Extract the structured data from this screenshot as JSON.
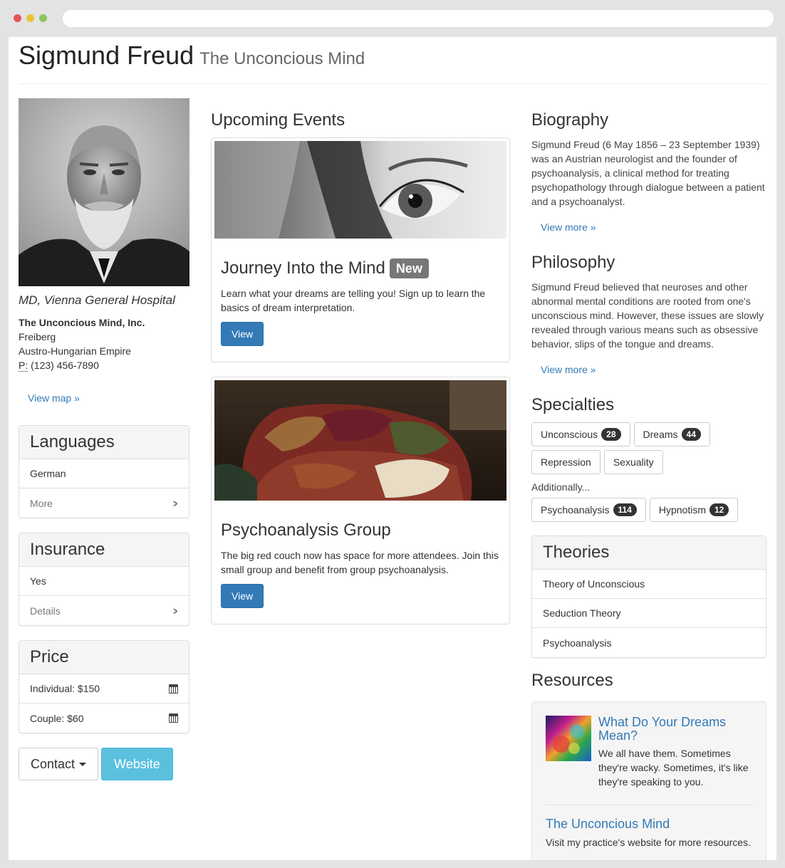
{
  "header": {
    "title": "Sigmund Freud",
    "subtitle": "The Unconcious Mind"
  },
  "profile": {
    "credential": "MD, Vienna General Hospital",
    "org": "The Unconcious Mind, Inc.",
    "city": "Freiberg",
    "country": "Austro-Hungarian Empire",
    "phone_abbr": "P:",
    "phone": "(123) 456-7890",
    "view_map": "View map »"
  },
  "languages": {
    "title": "Languages",
    "items": [
      "German"
    ],
    "more": "More"
  },
  "insurance": {
    "title": "Insurance",
    "value": "Yes",
    "details": "Details"
  },
  "price": {
    "title": "Price",
    "items": [
      "Individual: $150",
      "Couple: $60"
    ]
  },
  "actions": {
    "contact": "Contact",
    "website": "Website"
  },
  "events": {
    "title": "Upcoming Events",
    "items": [
      {
        "title": "Journey Into the Mind",
        "badge": "New",
        "text": "Learn what your dreams are telling you! Sign up to learn the basics of dream interpretation.",
        "button": "View"
      },
      {
        "title": "Psychoanalysis Group",
        "text": "The big red couch now has space for more attendees. Join this small group and benefit from group psychoanalysis.",
        "button": "View"
      }
    ]
  },
  "biography": {
    "title": "Biography",
    "text": "Sigmund Freud (6 May 1856 – 23 September 1939) was an Austrian neurologist and the founder of psychoanalysis, a clinical method for treating psychopathology through dialogue between a patient and a psychoanalyst.",
    "link": "View more »"
  },
  "philosophy": {
    "title": "Philosophy",
    "text": "Sigmund Freud believed that neuroses and other abnormal mental conditions are rooted from one's unconscious mind. However, these issues are slowly revealed through various means such as obsessive behavior, slips of the tongue and dreams.",
    "link": "View more »"
  },
  "specialties": {
    "title": "Specialties",
    "primary": [
      {
        "label": "Unconscious",
        "count": "28"
      },
      {
        "label": "Dreams",
        "count": "44"
      },
      {
        "label": "Repression"
      },
      {
        "label": "Sexuality"
      }
    ],
    "additionally": "Additionally...",
    "secondary": [
      {
        "label": "Psychoanalysis",
        "count": "114"
      },
      {
        "label": "Hypnotism",
        "count": "12"
      }
    ]
  },
  "theories": {
    "title": "Theories",
    "items": [
      "Theory of Unconscious",
      "Seduction Theory",
      "Psychoanalysis"
    ]
  },
  "resources": {
    "title": "Resources",
    "item1_title": "What Do Your Dreams Mean?",
    "item1_text": "We all have them. Sometimes they're wacky. Sometimes, it's like they're speaking to you.",
    "item2_title": "The Unconcious Mind",
    "item2_text": "Visit my practice's website for more resources."
  },
  "colors": {
    "link": "#337ab7",
    "primary_button": "#337ab7",
    "info_button": "#5bc0de",
    "badge": "#333333",
    "label_default": "#777777"
  }
}
